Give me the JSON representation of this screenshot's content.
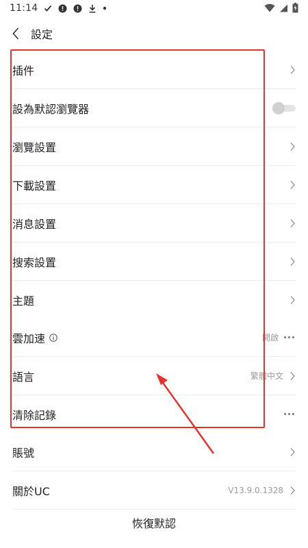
{
  "statusbar": {
    "time": "11:14",
    "icons_left": [
      "check-icon",
      "alert-circle-icon",
      "alert-circle-icon",
      "download-icon",
      "dot-icon"
    ],
    "icons_right": [
      "wifi-icon",
      "signal-icon",
      "battery-icon"
    ]
  },
  "titlebar": {
    "back_icon": "chevron-left-icon",
    "title": "設定"
  },
  "settings": [
    {
      "label": "插件",
      "type": "nav"
    },
    {
      "label": "設為默認瀏覽器",
      "type": "toggle",
      "toggle_on": false
    },
    {
      "label": "瀏覽設置",
      "type": "nav"
    },
    {
      "label": "下載設置",
      "type": "nav"
    },
    {
      "label": "消息設置",
      "type": "nav"
    },
    {
      "label": "搜索設置",
      "type": "nav"
    },
    {
      "label": "主題",
      "type": "nav"
    },
    {
      "label": "雲加速",
      "type": "more",
      "value": "開啟",
      "has_info_icon": true
    },
    {
      "label": "語言",
      "type": "nav",
      "value": "繁體中文"
    },
    {
      "label": "清除記錄",
      "type": "more"
    },
    {
      "label": "賬號",
      "type": "nav"
    },
    {
      "label": "關於UC",
      "type": "nav",
      "value": "V13.9.0.1328"
    }
  ],
  "footer": {
    "restore_label": "恢復默認"
  },
  "annotation": {
    "box_color": "#e5322d",
    "arrow_color": "#e5322d"
  }
}
